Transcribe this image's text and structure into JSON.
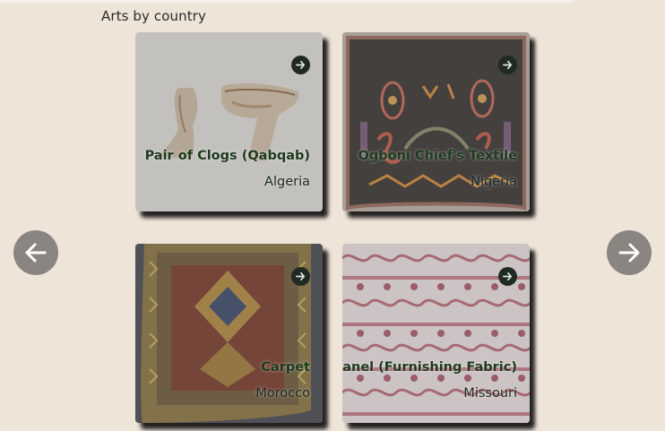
{
  "section": {
    "title": "Arts by country"
  },
  "cards": [
    {
      "title": "Pair of Clogs (Qabqab)",
      "place": "Algeria"
    },
    {
      "title": "Ogboni Chief's Textile",
      "place": "Nigeria"
    },
    {
      "title": "Carpet",
      "place": "Morocco"
    },
    {
      "title": "Panel (Furnishing Fabric)",
      "place": "Missouri"
    }
  ],
  "icons": {
    "open": "arrow-right-icon",
    "prev": "arrow-left-icon",
    "next": "arrow-right-icon"
  },
  "colors": {
    "background": "#efe4d8",
    "nav_button": "#8a8580",
    "card_title": "#1e3a1e"
  }
}
